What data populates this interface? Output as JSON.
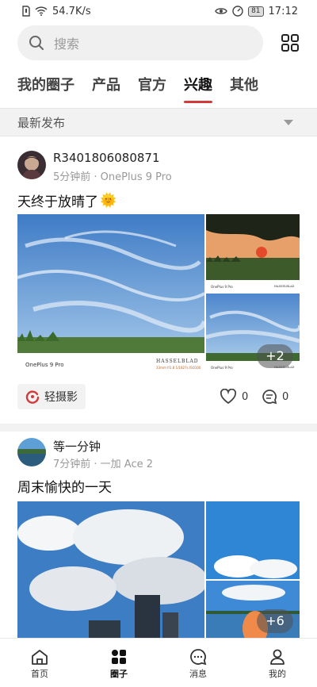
{
  "status_bar": {
    "speed": "54.7K/s",
    "battery": "81",
    "time": "17:12"
  },
  "search": {
    "placeholder": "搜索"
  },
  "tabs": [
    {
      "label": "我的圈子"
    },
    {
      "label": "产品"
    },
    {
      "label": "官方"
    },
    {
      "label": "兴趣",
      "active": true
    },
    {
      "label": "其他"
    }
  ],
  "filter": {
    "label": "最新发布"
  },
  "posts": [
    {
      "author": "R3401806080871",
      "meta": "5分钟前 · OnePlus 9 Pro",
      "text": "天终于放晴了",
      "emoji": "🌞",
      "photo_more": "+2",
      "watermark": {
        "model": "OnePlus 9 Pro",
        "brand": "HASSELBLAD",
        "specs": "33mm f/1.8 1/1827s ISO100"
      },
      "tag": "轻摄影",
      "likes": "0",
      "comments": "0"
    },
    {
      "author": "等一分钟",
      "meta": "7分钟前 · 一加 Ace 2",
      "text": "周末愉快的一天",
      "photo_more": "+6",
      "tag": "",
      "likes": "",
      "comments": ""
    }
  ],
  "bottom_nav": [
    {
      "label": "首页",
      "icon": "home-icon"
    },
    {
      "label": "圈子",
      "icon": "circles-icon",
      "active": true
    },
    {
      "label": "消息",
      "icon": "message-icon"
    },
    {
      "label": "我的",
      "icon": "profile-icon"
    }
  ],
  "colors": {
    "accent": "#d33a3a",
    "background": "#ffffff",
    "muted": "#f2f2f2"
  }
}
